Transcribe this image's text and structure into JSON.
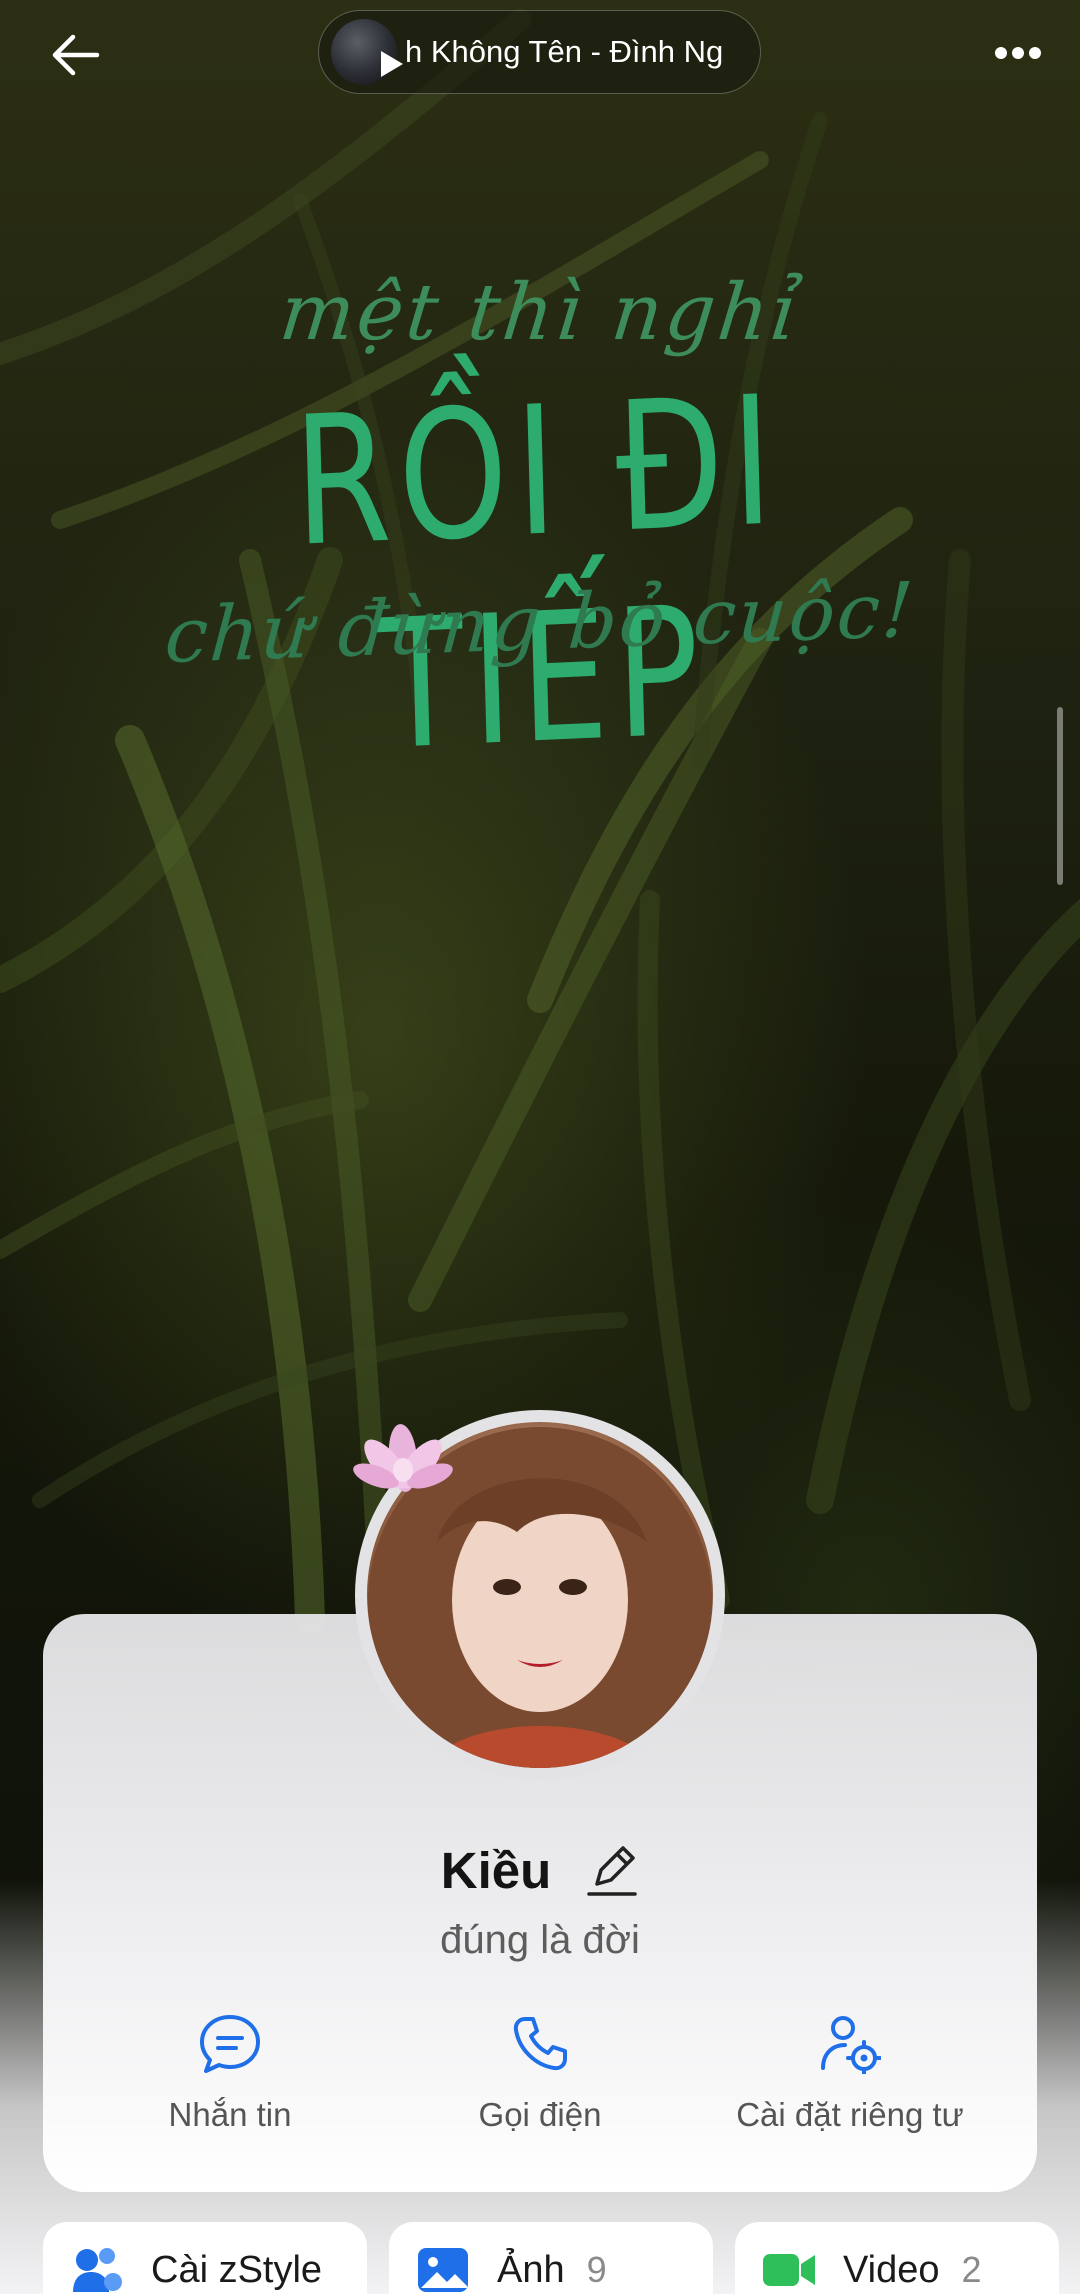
{
  "top_bar": {
    "back_icon": "arrow-left-icon",
    "music_title": "h Không Tên - Đình Ngu",
    "more_icon": "more-horizontal-icon"
  },
  "cover_quote": {
    "line1": "mệt thì nghỉ",
    "line2": "RỒI ĐI TIẾP",
    "line3": "chứ đừng bỏ cuộc!"
  },
  "profile": {
    "name": "Kiều",
    "status": "đúng là đời"
  },
  "actions": [
    {
      "label": "Nhắn tin",
      "icon": "chat-bubble-icon"
    },
    {
      "label": "Gọi điện",
      "icon": "phone-icon"
    },
    {
      "label": "Cài đặt riêng tư",
      "icon": "user-settings-icon"
    }
  ],
  "tiles": [
    {
      "label": "Cài zStyle",
      "count": "",
      "icon": "zstyle-icon"
    },
    {
      "label": "Ảnh",
      "count": "9",
      "icon": "image-icon"
    },
    {
      "label": "Video",
      "count": "2",
      "icon": "video-icon"
    }
  ],
  "colors": {
    "accent_blue": "#1f6fe8",
    "quote_green": "#2eab6e",
    "video_green": "#2fbf5a"
  }
}
